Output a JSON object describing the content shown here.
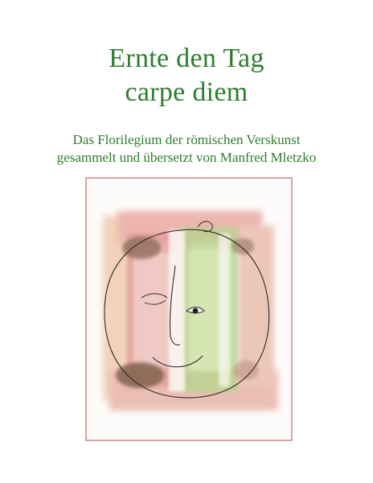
{
  "cover": {
    "title_line1": "Ernte den Tag",
    "title_line2": "carpe diem",
    "subtitle_line1": "Das Florilegium der römischen Verskunst",
    "subtitle_line2": "gesammelt und übersetzt von Manfred Mletzko",
    "colors": {
      "title": "#2f7d2f",
      "frame": "#c9817c",
      "wash_pink": "#e3a39a",
      "wash_green": "#b9d58f",
      "wash_brown": "#8a6a55"
    },
    "artwork_icon": "watercolor-face-illustration"
  }
}
